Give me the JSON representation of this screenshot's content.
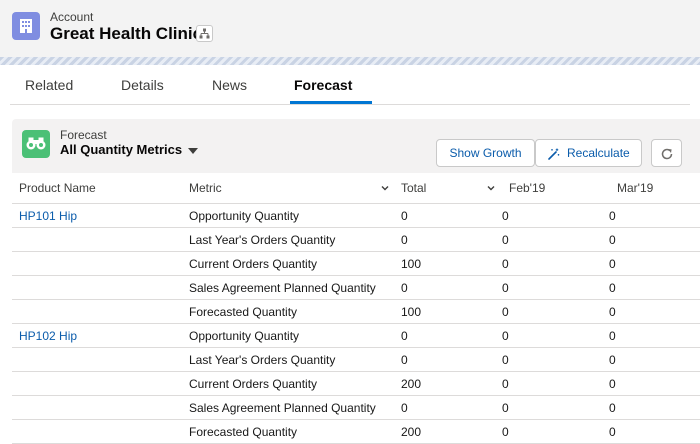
{
  "header": {
    "object_label": "Account",
    "record_title": "Great Health Clinic",
    "icons": {
      "record": "building-icon",
      "hierarchy": "hierarchy-icon"
    }
  },
  "tabs": [
    {
      "label": "Related",
      "active": false
    },
    {
      "label": "Details",
      "active": false
    },
    {
      "label": "News",
      "active": false
    },
    {
      "label": "Forecast",
      "active": true
    }
  ],
  "forecast": {
    "label": "Forecast",
    "view": "All Quantity Metrics",
    "icons": {
      "card": "binoculars-icon",
      "recalc": "magic-wand-icon",
      "refresh": "refresh-icon"
    },
    "buttons": {
      "show_growth": "Show Growth",
      "recalculate": "Recalculate"
    }
  },
  "table": {
    "columns": [
      "Product Name",
      "Metric",
      "Total",
      "Feb'19",
      "Mar'19"
    ],
    "rows": [
      {
        "product": "HP101 Hip",
        "metric": "Opportunity Quantity",
        "total": "0",
        "feb": "0",
        "mar": "0"
      },
      {
        "product": "",
        "metric": "Last Year's Orders Quantity",
        "total": "0",
        "feb": "0",
        "mar": "0"
      },
      {
        "product": "",
        "metric": "Current Orders Quantity",
        "total": "100",
        "feb": "0",
        "mar": "0"
      },
      {
        "product": "",
        "metric": "Sales Agreement Planned Quantity",
        "total": "0",
        "feb": "0",
        "mar": "0"
      },
      {
        "product": "",
        "metric": "Forecasted Quantity",
        "total": "100",
        "feb": "0",
        "mar": "0"
      },
      {
        "product": "HP102 Hip",
        "metric": "Opportunity Quantity",
        "total": "0",
        "feb": "0",
        "mar": "0"
      },
      {
        "product": "",
        "metric": "Last Year's Orders Quantity",
        "total": "0",
        "feb": "0",
        "mar": "0"
      },
      {
        "product": "",
        "metric": "Current Orders Quantity",
        "total": "200",
        "feb": "0",
        "mar": "0"
      },
      {
        "product": "",
        "metric": "Sales Agreement Planned Quantity",
        "total": "0",
        "feb": "0",
        "mar": "0"
      },
      {
        "product": "",
        "metric": "Forecasted Quantity",
        "total": "200",
        "feb": "0",
        "mar": "0"
      }
    ]
  },
  "colors": {
    "brand": "#0176d3",
    "link": "#0b5cab",
    "record_icon": "#7f8de1",
    "forecast_icon": "#4bc076"
  }
}
